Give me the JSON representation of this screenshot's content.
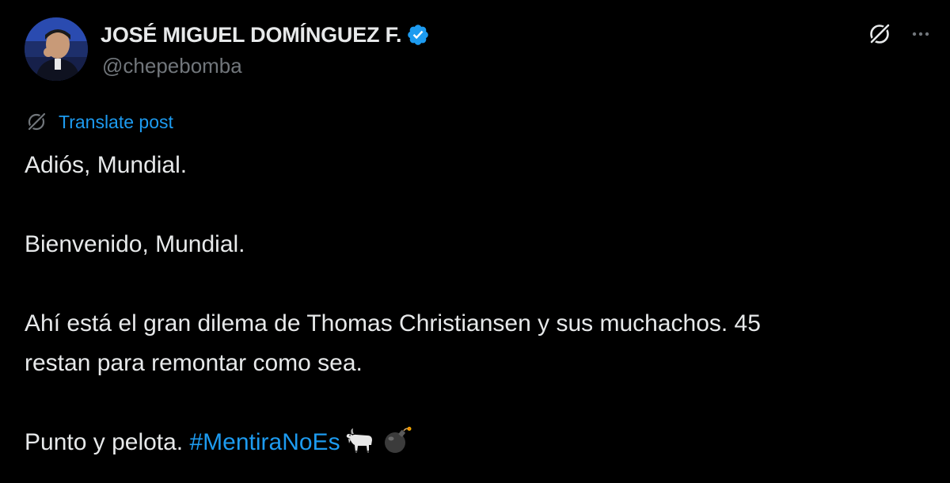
{
  "author": {
    "display_name": "JOSÉ MIGUEL DOMÍNGUEZ F.",
    "handle": "@chepebomba",
    "verified": true
  },
  "header_actions": {
    "grok_icon": "grok-slash-circle-icon",
    "more_icon": "more-horizontal-icon"
  },
  "translate": {
    "label": "Translate post",
    "icon": "translate-icon"
  },
  "post": {
    "paragraph_1": "Adiós, Mundial.",
    "paragraph_2": "Bienvenido, Mundial.",
    "paragraph_3_line_1": "Ahí está el gran dilema de Thomas Christiansen y sus muchachos. 45",
    "paragraph_3_line_2": "restan para remontar como sea.",
    "paragraph_4_text": "Punto y pelota. ",
    "hashtag": "#MentiraNoEs",
    "emojis": [
      "goat-emoji",
      "bomb-emoji"
    ]
  },
  "colors": {
    "background": "#000000",
    "text_primary": "#e7e9ea",
    "text_secondary": "#71767b",
    "accent": "#1d9bf0"
  }
}
